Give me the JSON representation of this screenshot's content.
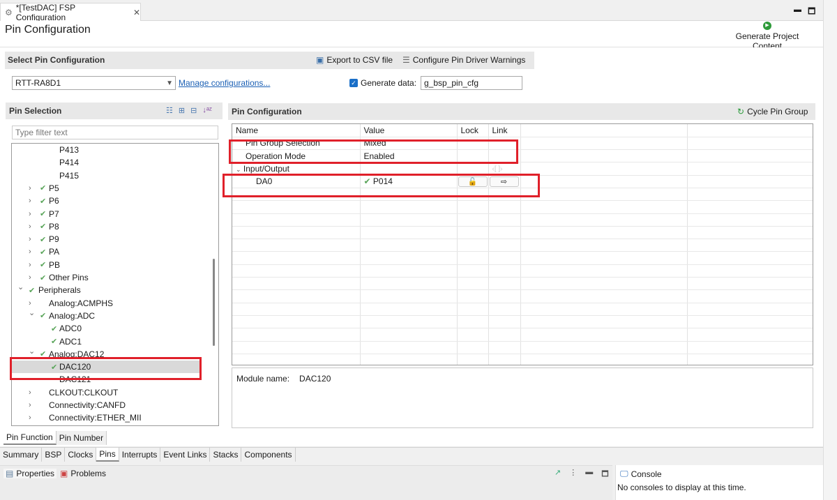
{
  "editor_tab": {
    "title": "*[TestDAC] FSP Configuration",
    "icon": "gear-icon"
  },
  "page_title": "Pin Configuration",
  "generate_button": "Generate Project Content",
  "select_section": {
    "title": "Select Pin Configuration",
    "export_label": "Export to CSV file",
    "warnings_label": "Configure Pin Driver Warnings",
    "selected_config": "RTT-RA8D1",
    "manage_link": "Manage configurations...",
    "generate_data_label": "Generate data:",
    "generate_data_checked": true,
    "generate_data_value": "g_bsp_pin_cfg"
  },
  "pin_selection": {
    "title": "Pin Selection",
    "filter_placeholder": "Type filter text",
    "items": [
      {
        "label": "P413",
        "level": 3,
        "chevron": "",
        "check": false
      },
      {
        "label": "P414",
        "level": 3,
        "chevron": "",
        "check": false
      },
      {
        "label": "P415",
        "level": 3,
        "chevron": "",
        "check": false
      },
      {
        "label": "P5",
        "level": 2,
        "chevron": "right",
        "check": true
      },
      {
        "label": "P6",
        "level": 2,
        "chevron": "right",
        "check": true
      },
      {
        "label": "P7",
        "level": 2,
        "chevron": "right",
        "check": true
      },
      {
        "label": "P8",
        "level": 2,
        "chevron": "right",
        "check": true
      },
      {
        "label": "P9",
        "level": 2,
        "chevron": "right",
        "check": true
      },
      {
        "label": "PA",
        "level": 2,
        "chevron": "right",
        "check": true
      },
      {
        "label": "PB",
        "level": 2,
        "chevron": "right",
        "check": true
      },
      {
        "label": "Other Pins",
        "level": 2,
        "chevron": "right",
        "check": true
      },
      {
        "label": "Peripherals",
        "level": 1,
        "chevron": "down",
        "check": true
      },
      {
        "label": "Analog:ACMPHS",
        "level": 2,
        "chevron": "right",
        "check": false
      },
      {
        "label": "Analog:ADC",
        "level": 2,
        "chevron": "down",
        "check": true
      },
      {
        "label": "ADC0",
        "level": 3,
        "chevron": "",
        "check": true
      },
      {
        "label": "ADC1",
        "level": 3,
        "chevron": "",
        "check": true
      },
      {
        "label": "Analog:DAC12",
        "level": 2,
        "chevron": "down",
        "check": true
      },
      {
        "label": "DAC120",
        "level": 3,
        "chevron": "",
        "check": true,
        "selected": true
      },
      {
        "label": "DAC121",
        "level": 3,
        "chevron": "",
        "check": false
      },
      {
        "label": "CLKOUT:CLKOUT",
        "level": 2,
        "chevron": "right",
        "check": false
      },
      {
        "label": "Connectivity:CANFD",
        "level": 2,
        "chevron": "right",
        "check": false
      },
      {
        "label": "Connectivity:ETHER_MII",
        "level": 2,
        "chevron": "right",
        "check": false
      }
    ]
  },
  "pin_config": {
    "title": "Pin Configuration",
    "cycle_label": "Cycle Pin Group",
    "columns": [
      "Name",
      "Value",
      "Lock",
      "Link"
    ],
    "rows": [
      {
        "name": "Pin Group Selection",
        "value": "Mixed"
      },
      {
        "name": "Operation Mode",
        "value": "Enabled"
      },
      {
        "name": "Input/Output",
        "value": "",
        "group": true
      },
      {
        "name": "DA0",
        "value": "P014",
        "check": true,
        "lock": "unlocked",
        "link": "arrow-right"
      }
    ],
    "module_label": "Module name:",
    "module_value": "DAC120"
  },
  "sub_tabs": [
    "Pin Function",
    "Pin Number"
  ],
  "editor_tabs": [
    "Summary",
    "BSP",
    "Clocks",
    "Pins",
    "Interrupts",
    "Event Links",
    "Stacks",
    "Components"
  ],
  "active_editor_tab": "Pins",
  "bottom": {
    "properties": "Properties",
    "problems": "Problems",
    "console": "Console",
    "console_msg": "No consoles to display at this time."
  },
  "colors": {
    "highlight": "#e0202a",
    "check": "#5aa55a",
    "link": "#1a5fb4"
  }
}
